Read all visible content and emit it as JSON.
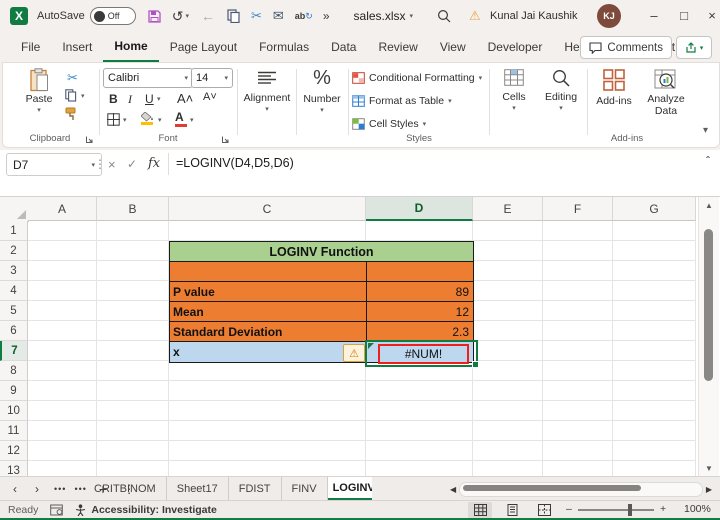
{
  "title_bar": {
    "autosave_label": "AutoSave",
    "autosave_state": "Off",
    "more_commands": "»",
    "file_name": "sales.xlsx",
    "user_name": "Kunal Jai Kaushik",
    "user_initials": "KJ"
  },
  "ribbon": {
    "tabs": [
      "File",
      "Insert",
      "Home",
      "Page Layout",
      "Formulas",
      "Data",
      "Review",
      "View",
      "Developer",
      "Help",
      "Power Pivot"
    ],
    "active_tab": "Home",
    "comments_label": "Comments",
    "clipboard_group": {
      "label": "Clipboard",
      "paste_label": "Paste"
    },
    "font_group": {
      "label": "Font",
      "font_name": "Calibri",
      "font_size": "14",
      "bold": "B",
      "italic": "I",
      "underline": "U"
    },
    "alignment_group": {
      "label": "Alignment"
    },
    "number_group": {
      "label": "Number",
      "percent": "%"
    },
    "styles_group": {
      "label": "Styles",
      "conditional_formatting": "Conditional Formatting",
      "format_as_table": "Format as Table",
      "cell_styles": "Cell Styles"
    },
    "cells_group": {
      "label": "Cells"
    },
    "editing_group": {
      "label": "Editing"
    },
    "addins_group": {
      "label": "Add-ins",
      "addins_button": "Add-ins",
      "analyze_data_button": "Analyze Data"
    }
  },
  "formula_bar": {
    "name_box": "D7",
    "formula": "=LOGINV(D4,D5,D6)",
    "fx_label": "fx"
  },
  "grid": {
    "columns": [
      "A",
      "B",
      "C",
      "D",
      "E",
      "F",
      "G"
    ],
    "selected_column": "D",
    "row_numbers": [
      "1",
      "2",
      "3",
      "4",
      "5",
      "6",
      "7",
      "8",
      "9",
      "10",
      "11",
      "12",
      "13"
    ],
    "selected_row": "7",
    "selected_cell": "D7"
  },
  "table": {
    "title": "LOGINV Function",
    "rows": [
      {
        "label": "P value",
        "value": "89"
      },
      {
        "label": "Mean",
        "value": "12"
      },
      {
        "label": "Standard Deviation",
        "value": "2.3"
      }
    ],
    "result_row": {
      "label": "x",
      "value": "#NUM!"
    },
    "colors": {
      "header_green": "#A9D08E",
      "body_orange": "#ED7D31",
      "result_blue": "#BDD7EE",
      "error_red": "#EF1F1F",
      "selection_green": "#107C41"
    }
  },
  "sheet_tabs": {
    "tabs": [
      "CRITBINOM",
      "Sheet17",
      "FDIST",
      "FINV",
      "LOGINV"
    ],
    "active_tab": "LOGINV"
  },
  "status_bar": {
    "mode": "Ready",
    "accessibility": "Accessibility: Investigate",
    "zoom_level": "100%"
  }
}
